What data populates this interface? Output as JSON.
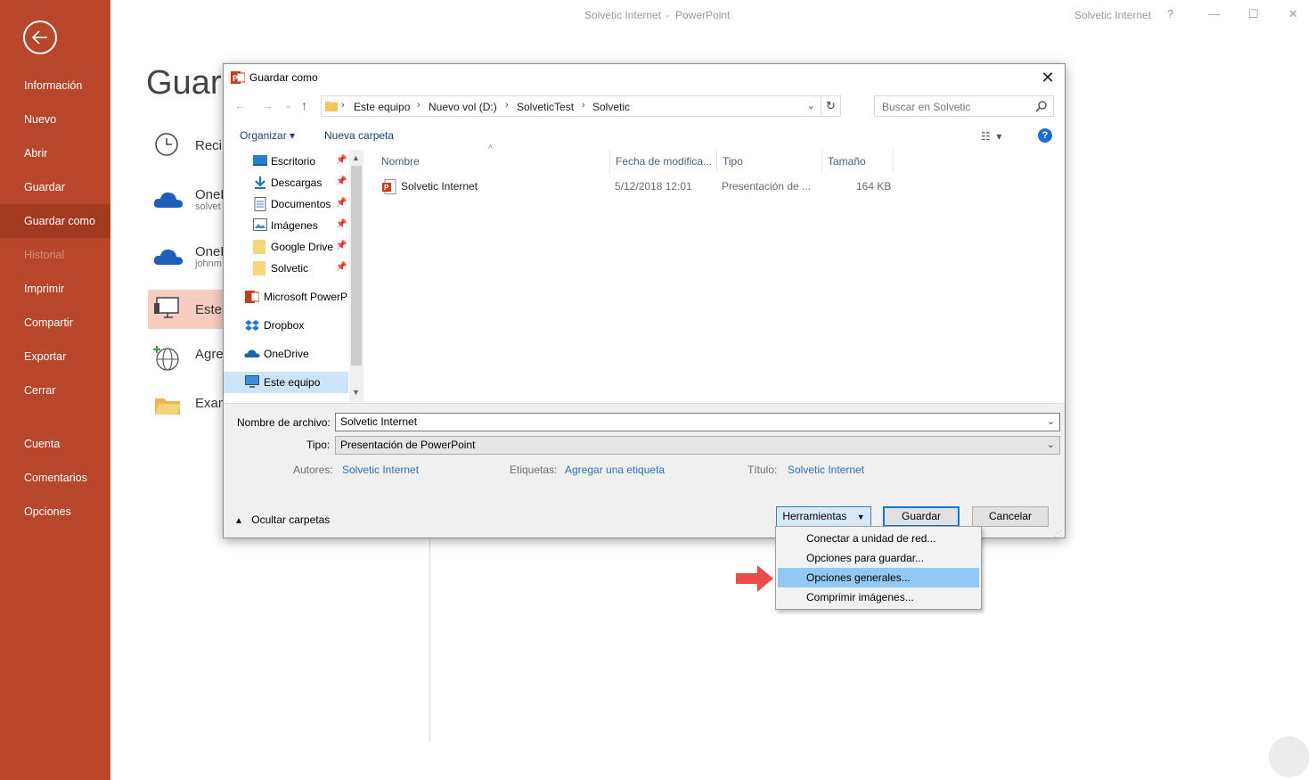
{
  "app": {
    "title_doc": "Solvetic Internet",
    "title_sep": "-",
    "title_app": "PowerPoint",
    "user": "Solvetic Internet",
    "help_glyph": "?",
    "minimize_glyph": "—",
    "maximize_glyph": "☐",
    "close_glyph": "✕"
  },
  "sidebar": {
    "items": [
      {
        "label": "Información"
      },
      {
        "label": "Nuevo"
      },
      {
        "label": "Abrir"
      },
      {
        "label": "Guardar"
      },
      {
        "label": "Guardar como"
      },
      {
        "label": "Historial"
      },
      {
        "label": "Imprimir"
      },
      {
        "label": "Compartir"
      },
      {
        "label": "Exportar"
      },
      {
        "label": "Cerrar"
      },
      {
        "label": "Cuenta"
      },
      {
        "label": "Comentarios"
      },
      {
        "label": "Opciones"
      }
    ]
  },
  "backstage": {
    "heading": "Guard",
    "places": [
      {
        "label": "Reci",
        "sub": ""
      },
      {
        "label": "OneD",
        "sub": "solvet"
      },
      {
        "label": "OneD",
        "sub": "johnm"
      },
      {
        "label": "Este",
        "sub": ""
      },
      {
        "label": "Agre",
        "sub": ""
      },
      {
        "label": "Exam",
        "sub": ""
      }
    ]
  },
  "dialog": {
    "title": "Guardar como",
    "close_glyph": "✕",
    "nav": {
      "back": "←",
      "forward": "→",
      "recent": "⌄",
      "up": "↑"
    },
    "breadcrumb": [
      "Este equipo",
      "Nuevo vol (D:)",
      "SolveticTest",
      "Solvetic"
    ],
    "breadcrumb_sep": "›",
    "search_placeholder": "Buscar en Solvetic",
    "toolbar": {
      "organize": "Organizar ▾",
      "new_folder": "Nueva carpeta",
      "help": "?"
    },
    "nav_pane": [
      {
        "label": "Escritorio",
        "pinned": true
      },
      {
        "label": "Descargas",
        "pinned": true
      },
      {
        "label": "Documentos",
        "pinned": true
      },
      {
        "label": "Imágenes",
        "pinned": true
      },
      {
        "label": "Google Drive",
        "pinned": true
      },
      {
        "label": "Solvetic",
        "pinned": true
      },
      {
        "label": "Microsoft PowerP"
      },
      {
        "label": "Dropbox"
      },
      {
        "label": "OneDrive"
      },
      {
        "label": "Este equipo",
        "selected": true
      }
    ],
    "columns": [
      "Nombre",
      "Fecha de modifica...",
      "Tipo",
      "Tamaño"
    ],
    "files": [
      {
        "name": "Solvetic Internet",
        "date": "5/12/2018 12:01",
        "type": "Presentación de ...",
        "size": "164 KB"
      }
    ],
    "form": {
      "filename_label": "Nombre de archivo:",
      "filename_value": "Solvetic Internet",
      "type_label": "Tipo:",
      "type_value": "Presentación de PowerPoint",
      "authors_label": "Autores:",
      "authors_value": "Solvetic Internet",
      "tags_label": "Etiquetas:",
      "tags_value": "Agregar una etiqueta",
      "title_label": "Título:",
      "title_value": "Solvetic Internet",
      "hide_folders": "Ocultar carpetas",
      "tools": "Herramientas",
      "save": "Guardar",
      "cancel": "Cancelar"
    },
    "tools_menu": [
      {
        "label": "Conectar a unidad de red..."
      },
      {
        "label": "Opciones para guardar..."
      },
      {
        "label": "Opciones generales...",
        "highlighted": true
      },
      {
        "label": "Comprimir imágenes..."
      }
    ]
  },
  "colors": {
    "accent": "#b7472a",
    "link": "#2f6fb5",
    "highlight": "#91c9f7",
    "arrow": "#ee4b4b"
  }
}
